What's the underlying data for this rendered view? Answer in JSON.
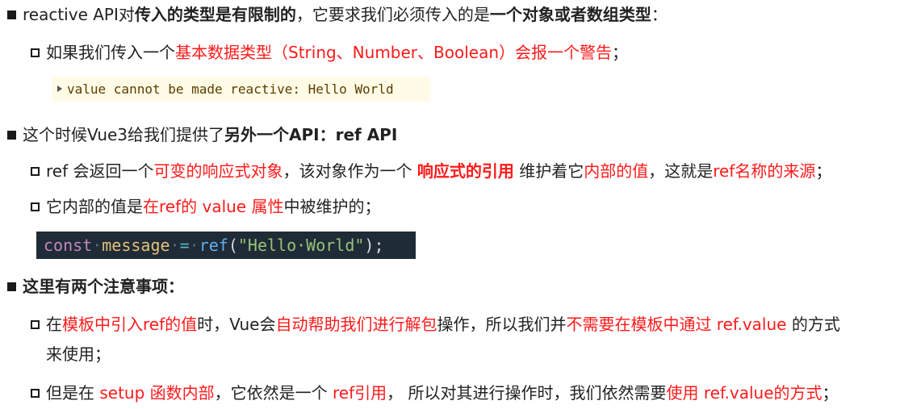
{
  "sections": [
    {
      "text": {
        "p1": "reactive API对",
        "p2": "传入的类型是有限制的",
        "p3": "，它要求我们必须传入的是",
        "p4": "一个对象或者数组类型",
        "p5": "："
      },
      "items": [
        {
          "p1": "如果我们传入一个",
          "p2": "基本数据类型（String、Number、Boolean）会报一个警告",
          "p3": "；"
        }
      ],
      "console_warning": "value cannot be made reactive: Hello World"
    },
    {
      "text": {
        "p1": "这个时候Vue3给我们提供了",
        "p2": "另外一个API：ref API"
      },
      "items": [
        {
          "p1": "ref 会返回一个",
          "p2": "可变的响应式对象",
          "p3": "，该对象作为一个 ",
          "p4": "响应式的引用",
          "p5": " 维护着它",
          "p6": "内部的值",
          "p7": "，这就是",
          "p8": "ref名称的来源",
          "p9": "；"
        },
        {
          "p1": "它内部的值是",
          "p2": "在ref的 value 属性",
          "p3": "中被维护的；"
        }
      ],
      "code": {
        "kw": "const",
        "ws": "·",
        "var": "message",
        "op": "=",
        "fn": "ref",
        "open": "(",
        "str": "\"Hello·World\"",
        "close": ");"
      }
    },
    {
      "text": {
        "p1": "这里有两个注意事项："
      },
      "items": [
        {
          "p1": "在",
          "p2": "模板中引入ref的值",
          "p3": "时，Vue会",
          "p4": "自动帮助我们进行解包",
          "p5": "操作，所以我们并",
          "p6": "不需要在模板中通过 ref.value",
          "p7": " 的方式",
          "p8": "来使用；"
        },
        {
          "p1": "但是在 ",
          "p2": "setup 函数内部",
          "p3": "，它依然是一个 ",
          "p4": "ref引用",
          "p5": "， 所以对其进行操作时，我们依然需要",
          "p6": "使用 ref.value的方式",
          "p7": "；"
        }
      ]
    }
  ]
}
